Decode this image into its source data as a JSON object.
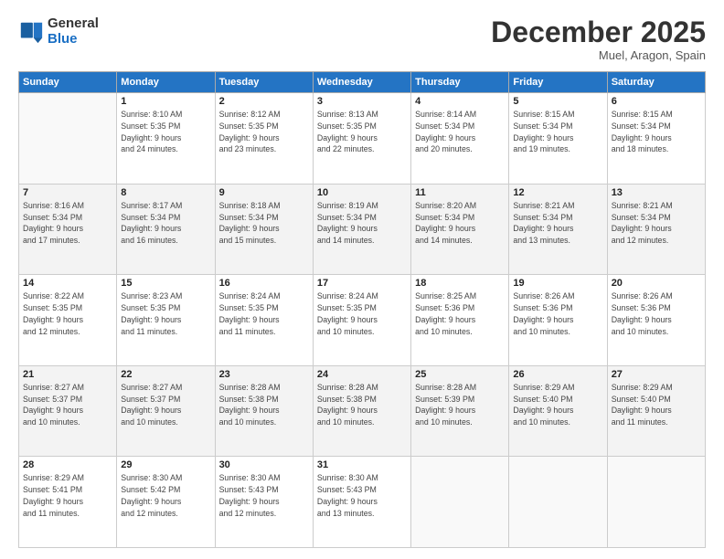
{
  "header": {
    "logo_line1": "General",
    "logo_line2": "Blue",
    "month": "December 2025",
    "location": "Muel, Aragon, Spain"
  },
  "weekdays": [
    "Sunday",
    "Monday",
    "Tuesday",
    "Wednesday",
    "Thursday",
    "Friday",
    "Saturday"
  ],
  "weeks": [
    [
      {
        "day": "",
        "info": ""
      },
      {
        "day": "1",
        "info": "Sunrise: 8:10 AM\nSunset: 5:35 PM\nDaylight: 9 hours\nand 24 minutes."
      },
      {
        "day": "2",
        "info": "Sunrise: 8:12 AM\nSunset: 5:35 PM\nDaylight: 9 hours\nand 23 minutes."
      },
      {
        "day": "3",
        "info": "Sunrise: 8:13 AM\nSunset: 5:35 PM\nDaylight: 9 hours\nand 22 minutes."
      },
      {
        "day": "4",
        "info": "Sunrise: 8:14 AM\nSunset: 5:34 PM\nDaylight: 9 hours\nand 20 minutes."
      },
      {
        "day": "5",
        "info": "Sunrise: 8:15 AM\nSunset: 5:34 PM\nDaylight: 9 hours\nand 19 minutes."
      },
      {
        "day": "6",
        "info": "Sunrise: 8:15 AM\nSunset: 5:34 PM\nDaylight: 9 hours\nand 18 minutes."
      }
    ],
    [
      {
        "day": "7",
        "info": "Sunrise: 8:16 AM\nSunset: 5:34 PM\nDaylight: 9 hours\nand 17 minutes."
      },
      {
        "day": "8",
        "info": "Sunrise: 8:17 AM\nSunset: 5:34 PM\nDaylight: 9 hours\nand 16 minutes."
      },
      {
        "day": "9",
        "info": "Sunrise: 8:18 AM\nSunset: 5:34 PM\nDaylight: 9 hours\nand 15 minutes."
      },
      {
        "day": "10",
        "info": "Sunrise: 8:19 AM\nSunset: 5:34 PM\nDaylight: 9 hours\nand 14 minutes."
      },
      {
        "day": "11",
        "info": "Sunrise: 8:20 AM\nSunset: 5:34 PM\nDaylight: 9 hours\nand 14 minutes."
      },
      {
        "day": "12",
        "info": "Sunrise: 8:21 AM\nSunset: 5:34 PM\nDaylight: 9 hours\nand 13 minutes."
      },
      {
        "day": "13",
        "info": "Sunrise: 8:21 AM\nSunset: 5:34 PM\nDaylight: 9 hours\nand 12 minutes."
      }
    ],
    [
      {
        "day": "14",
        "info": "Sunrise: 8:22 AM\nSunset: 5:35 PM\nDaylight: 9 hours\nand 12 minutes."
      },
      {
        "day": "15",
        "info": "Sunrise: 8:23 AM\nSunset: 5:35 PM\nDaylight: 9 hours\nand 11 minutes."
      },
      {
        "day": "16",
        "info": "Sunrise: 8:24 AM\nSunset: 5:35 PM\nDaylight: 9 hours\nand 11 minutes."
      },
      {
        "day": "17",
        "info": "Sunrise: 8:24 AM\nSunset: 5:35 PM\nDaylight: 9 hours\nand 10 minutes."
      },
      {
        "day": "18",
        "info": "Sunrise: 8:25 AM\nSunset: 5:36 PM\nDaylight: 9 hours\nand 10 minutes."
      },
      {
        "day": "19",
        "info": "Sunrise: 8:26 AM\nSunset: 5:36 PM\nDaylight: 9 hours\nand 10 minutes."
      },
      {
        "day": "20",
        "info": "Sunrise: 8:26 AM\nSunset: 5:36 PM\nDaylight: 9 hours\nand 10 minutes."
      }
    ],
    [
      {
        "day": "21",
        "info": "Sunrise: 8:27 AM\nSunset: 5:37 PM\nDaylight: 9 hours\nand 10 minutes."
      },
      {
        "day": "22",
        "info": "Sunrise: 8:27 AM\nSunset: 5:37 PM\nDaylight: 9 hours\nand 10 minutes."
      },
      {
        "day": "23",
        "info": "Sunrise: 8:28 AM\nSunset: 5:38 PM\nDaylight: 9 hours\nand 10 minutes."
      },
      {
        "day": "24",
        "info": "Sunrise: 8:28 AM\nSunset: 5:38 PM\nDaylight: 9 hours\nand 10 minutes."
      },
      {
        "day": "25",
        "info": "Sunrise: 8:28 AM\nSunset: 5:39 PM\nDaylight: 9 hours\nand 10 minutes."
      },
      {
        "day": "26",
        "info": "Sunrise: 8:29 AM\nSunset: 5:40 PM\nDaylight: 9 hours\nand 10 minutes."
      },
      {
        "day": "27",
        "info": "Sunrise: 8:29 AM\nSunset: 5:40 PM\nDaylight: 9 hours\nand 11 minutes."
      }
    ],
    [
      {
        "day": "28",
        "info": "Sunrise: 8:29 AM\nSunset: 5:41 PM\nDaylight: 9 hours\nand 11 minutes."
      },
      {
        "day": "29",
        "info": "Sunrise: 8:30 AM\nSunset: 5:42 PM\nDaylight: 9 hours\nand 12 minutes."
      },
      {
        "day": "30",
        "info": "Sunrise: 8:30 AM\nSunset: 5:43 PM\nDaylight: 9 hours\nand 12 minutes."
      },
      {
        "day": "31",
        "info": "Sunrise: 8:30 AM\nSunset: 5:43 PM\nDaylight: 9 hours\nand 13 minutes."
      },
      {
        "day": "",
        "info": ""
      },
      {
        "day": "",
        "info": ""
      },
      {
        "day": "",
        "info": ""
      }
    ]
  ]
}
